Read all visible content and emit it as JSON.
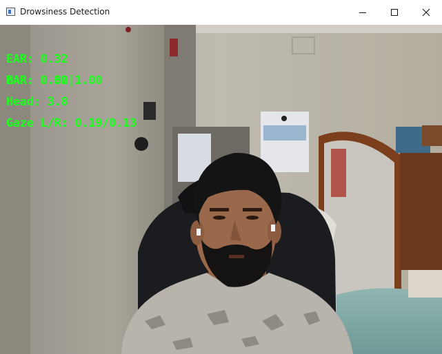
{
  "window": {
    "title": "Drowsiness Detection",
    "controls": {
      "minimize": "minimize-icon",
      "maximize": "maximize-icon",
      "close": "close-icon"
    }
  },
  "overlay": {
    "color": "#1cff1c",
    "ear": "EAR: 0.32",
    "mar_a": "EAR: 0.32",
    "mar_b": "MAR: 0.00|1.00",
    "head": "Head: 3.8",
    "gaze": "Gaze L/R: 0.19/0.13"
  }
}
